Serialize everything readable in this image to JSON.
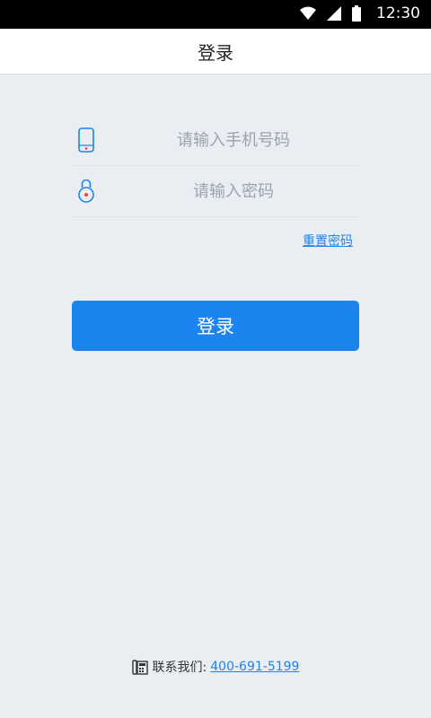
{
  "status_bar": {
    "time": "12:30"
  },
  "header": {
    "title": "登录"
  },
  "form": {
    "phone_placeholder": "请输入手机号码",
    "phone_value": "",
    "password_placeholder": "请输入密码",
    "password_value": "",
    "reset_label": "重置密码",
    "login_label": "登录"
  },
  "footer": {
    "contact_label": "联系我们:",
    "phone_number": "400-691-5199"
  },
  "colors": {
    "accent": "#1b84ee",
    "background": "#eaeef3",
    "icon_red": "#e8464b"
  }
}
